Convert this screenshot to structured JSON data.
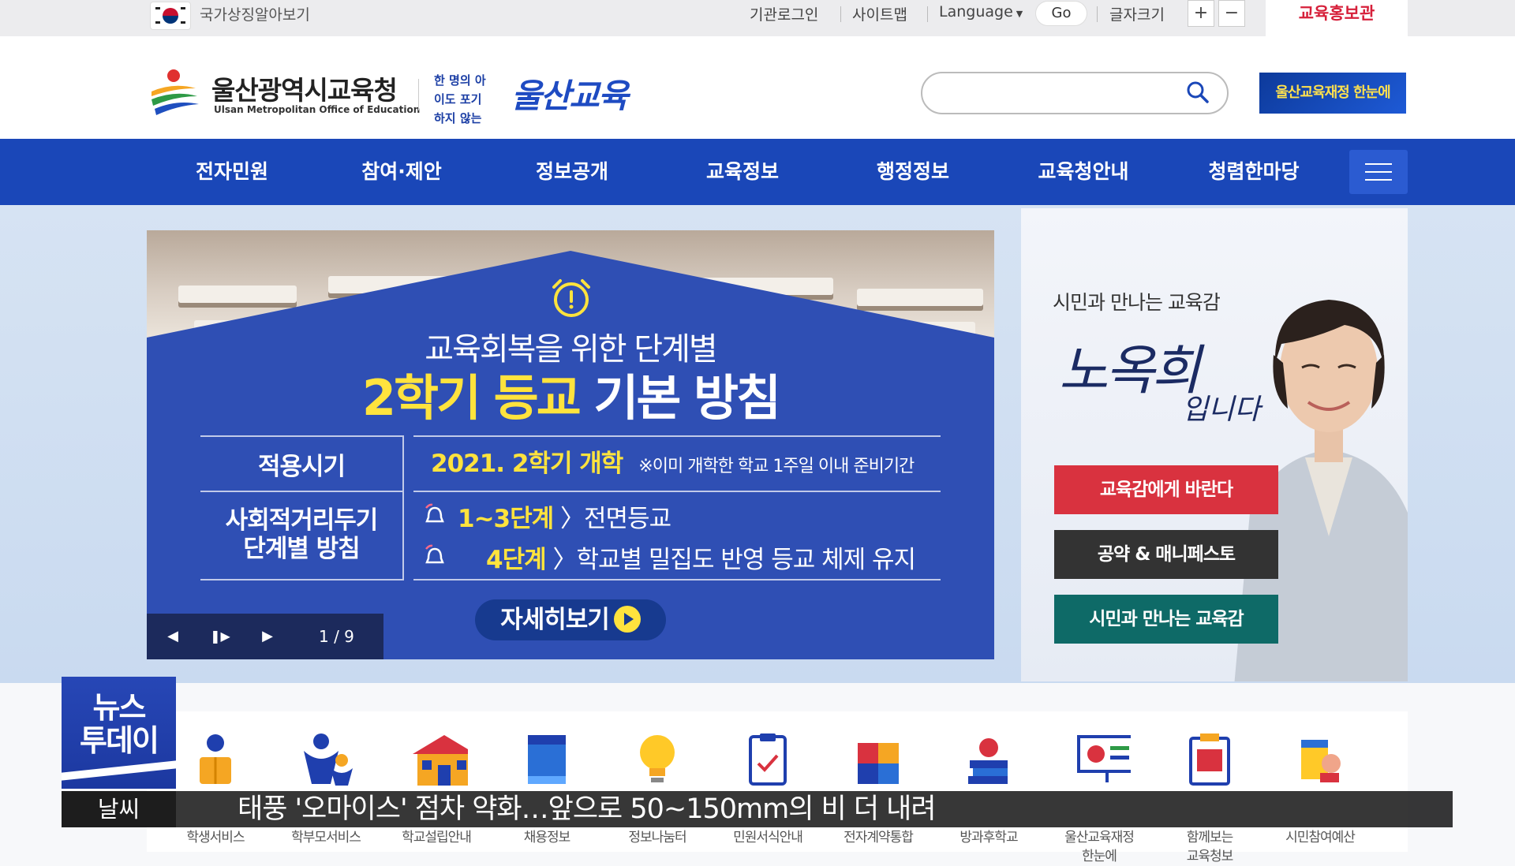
{
  "topbar": {
    "national_symbol": "국가상징알아보기",
    "login": "기관로그인",
    "sitemap": "사이트맵",
    "language": "Language",
    "go": "Go",
    "font_size": "글자크기",
    "plus": "+",
    "minus": "−",
    "promo_tab": "교육홍보관"
  },
  "header": {
    "org_name": "울산광역시교육청",
    "org_name_en": "Ulsan Metropolitan Office of Education",
    "slogan_small": "한 명의 아이도 포기하지 않는",
    "slogan_big": "울산교육",
    "search_placeholder": "",
    "banner_small": "울산교육재정 한눈에"
  },
  "nav": {
    "items": [
      "전자민원",
      "참여·제안",
      "정보공개",
      "교육정보",
      "행정정보",
      "교육청안내",
      "청렴한마당"
    ]
  },
  "slider": {
    "title1": "교육회복을 위한 단계별",
    "title2_hl": "2학기 등교",
    "title2_rest": " 기본 방침",
    "row1_head": "적용시기",
    "row1_value": "2021. 2학기 개학",
    "row1_note": "※이미 개학한 학교 1주일 이내 준비기간",
    "row2_head1": "사회적거리두기",
    "row2_head2": "단계별 방침",
    "step1_level": "1~3단계",
    "step1_text": "〉전면등교",
    "step2_level": "4단계",
    "step2_text": "〉학교별 밀집도 반영 등교 체제 유지",
    "detail_btn": "자세히보기",
    "counter": "1 / 9",
    "ctrl_prev": "◀",
    "ctrl_pause": "❚▶",
    "ctrl_next": "▶"
  },
  "right_panel": {
    "title": "시민과 만나는 교육감",
    "signature": "노옥희",
    "signature2": "입니다",
    "buttons": [
      {
        "label": "교육감에게 바란다",
        "color": "#d9323f"
      },
      {
        "label": "공약 & 매니페스토",
        "color": "#333333"
      },
      {
        "label": "시민과 만나는 교육감",
        "color": "#0e6a67"
      }
    ]
  },
  "quick_menu": {
    "items": [
      {
        "line1": "학생서비스",
        "line2": ""
      },
      {
        "line1": "학부모서비스",
        "line2": ""
      },
      {
        "line1": "학교설립안내",
        "line2": ""
      },
      {
        "line1": "",
        "line2": "채용정보"
      },
      {
        "line1": "",
        "line2": "정보나눔터"
      },
      {
        "line1": "민원서식안내",
        "line2": ""
      },
      {
        "line1": "전자계약통합",
        "line2": ""
      },
      {
        "line1": "방과후학교",
        "line2": ""
      },
      {
        "line1": "울산교육재정",
        "line2": "한눈에"
      },
      {
        "line1": "함께보는",
        "line2": "교육청보"
      },
      {
        "line1": "시민참여예산",
        "line2": ""
      }
    ]
  },
  "news_overlay": {
    "logo": "뉴스\n투데이",
    "logo_line1": "뉴스",
    "logo_line2": "투데이",
    "section": "날씨",
    "caption": "태풍 '오마이스' 점차 약화…앞으로 50~150mm의 비 더 내려"
  }
}
